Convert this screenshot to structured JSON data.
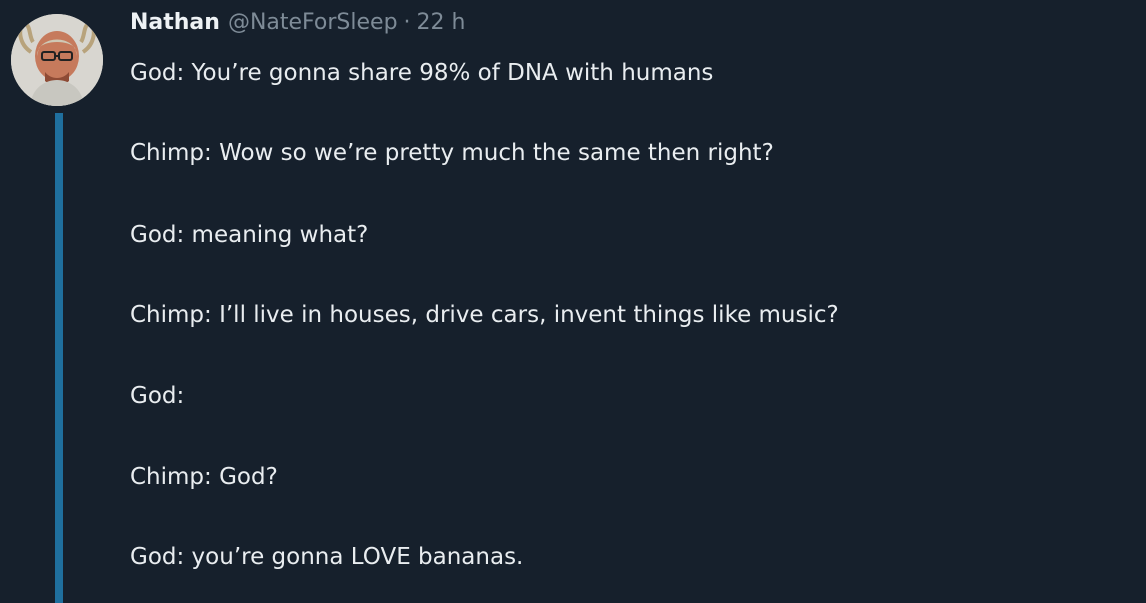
{
  "tweet": {
    "author_name": "Nathan",
    "handle": "@NateForSleep",
    "separator": "·",
    "time": "22 h",
    "lines": [
      "God: You’re gonna share 98% of DNA with humans",
      "Chimp: Wow so we’re pretty much the same then right?",
      "God: meaning what?",
      "Chimp: I’ll live in houses, drive cars, invent things like music?",
      "God:",
      "Chimp: God?",
      "God: you’re gonna LOVE bananas."
    ]
  },
  "colors": {
    "background": "#16202c",
    "thread_line": "#1f6f9e",
    "muted_text": "#7e8b97",
    "body_text": "#e9edf0"
  }
}
